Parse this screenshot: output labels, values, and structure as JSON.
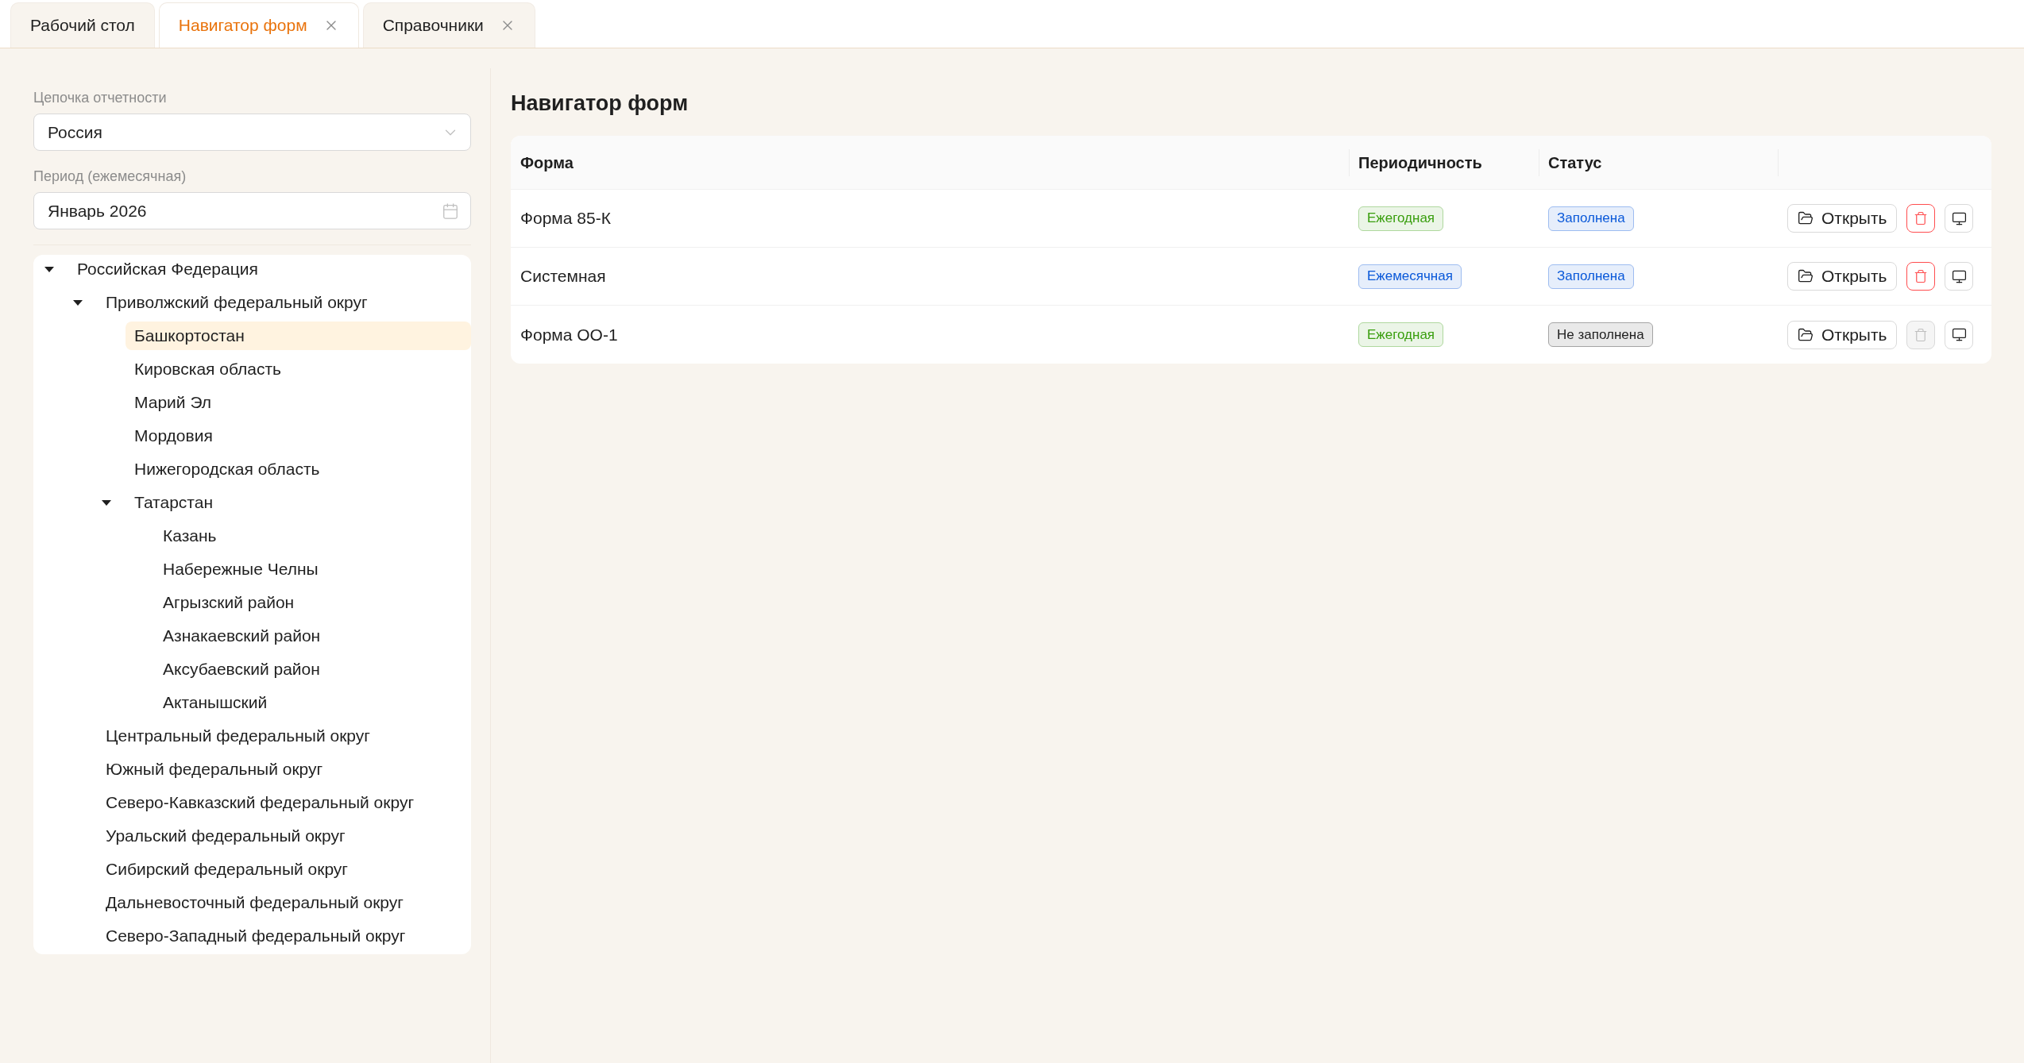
{
  "tabs": [
    {
      "label": "Рабочий стол",
      "selected": false,
      "closable": false
    },
    {
      "label": "Навигатор форм",
      "selected": true,
      "closable": true
    },
    {
      "label": "Справочники",
      "selected": false,
      "closable": true
    }
  ],
  "filters": {
    "chain": {
      "label": "Цепочка отчетности",
      "value": "Россия"
    },
    "period": {
      "label": "Период (ежемесячная)",
      "value": "Январь 2026"
    }
  },
  "tree": [
    {
      "label": "Российская Федерация",
      "expanded": true,
      "selected": false,
      "children": [
        {
          "label": "Приволжский федеральный округ",
          "expanded": true,
          "selected": false,
          "children": [
            {
              "label": "Башкортостан",
              "selected": true
            },
            {
              "label": "Кировская область",
              "selected": false
            },
            {
              "label": "Марий Эл",
              "selected": false
            },
            {
              "label": "Мордовия",
              "selected": false
            },
            {
              "label": "Нижегородская область",
              "selected": false
            },
            {
              "label": "Татарстан",
              "expanded": true,
              "selected": false,
              "children": [
                {
                  "label": "Казань",
                  "selected": false
                },
                {
                  "label": "Набережные Челны",
                  "selected": false
                },
                {
                  "label": "Агрызский район",
                  "selected": false
                },
                {
                  "label": "Азнакаевский район",
                  "selected": false
                },
                {
                  "label": "Аксубаевский район",
                  "selected": false
                },
                {
                  "label": "Актанышский",
                  "selected": false
                }
              ]
            }
          ]
        },
        {
          "label": "Центральный федеральный округ",
          "selected": false
        },
        {
          "label": "Южный федеральный округ",
          "selected": false
        },
        {
          "label": "Северо-Кавказский федеральный округ",
          "selected": false
        },
        {
          "label": "Уральский федеральный округ",
          "selected": false
        },
        {
          "label": "Сибирский федеральный округ",
          "selected": false
        },
        {
          "label": "Дальневосточный федеральный округ",
          "selected": false
        },
        {
          "label": "Северо-Западный федеральный округ",
          "selected": false
        }
      ]
    }
  ],
  "main": {
    "title": "Навигатор форм"
  },
  "table": {
    "columns": [
      "Форма",
      "Периодичность",
      "Статус"
    ],
    "rows": [
      {
        "form": "Форма 85-К",
        "periodicity": {
          "label": "Ежегодная",
          "color": "#389e0d"
        },
        "status": {
          "label": "Заполнена",
          "color": "#0958d9"
        },
        "open_button": "Открыть",
        "delete_button": {
          "disabled": false
        }
      },
      {
        "form": "Системная",
        "periodicity": {
          "label": "Ежемесячная",
          "color": "#0958d9"
        },
        "status": {
          "label": "Заполнена",
          "color": "#0958d9"
        },
        "open_button": "Открыть",
        "delete_button": {
          "disabled": false
        }
      },
      {
        "form": "Форма ОО-1",
        "periodicity": {
          "label": "Ежегодная",
          "color": "#389e0d"
        },
        "status": {
          "label": "Не заполнена",
          "color": "#1f1f1f"
        },
        "open_button": "Открыть",
        "delete_button": {
          "disabled": true
        }
      }
    ]
  }
}
